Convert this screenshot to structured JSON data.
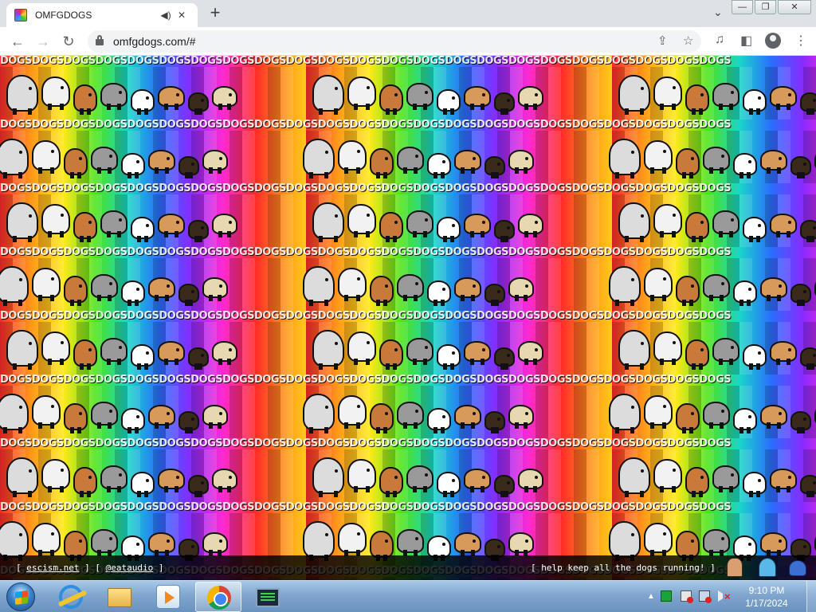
{
  "browser": {
    "tab_title": "OMFGDOGS",
    "url": "omfgdogs.com/#",
    "new_tab_label": "+",
    "tab_search_icon": "chevron-down-icon"
  },
  "page": {
    "background_text": "DOGSDOGSDOGSDOGSDOGSDOGSDOGSDOGSDOGSDOGSDOGSDOGSDOGSDOGSDOGSDOGSDOGSDOGSDOGSDOGSDOGSDOGSDOGS",
    "rainbow_colors": [
      "#ff2a2a",
      "#ff9a1a",
      "#ffe91a",
      "#4de31a",
      "#19d6c8",
      "#2a6dff",
      "#8a2aff",
      "#ff2ad1"
    ],
    "dog_colors": [
      "#dcdcdc",
      "#f2f2f2",
      "#c97a3a",
      "#9a9a9a",
      "#ffffff",
      "#d89a5a",
      "#3a2a1a",
      "#e8d8b0"
    ]
  },
  "footer": {
    "bracket_open": "[ ",
    "link1": "escism.net",
    "sep": " ] [ ",
    "link2": "@eataudio",
    "bracket_close": " ]",
    "right_text": "[ help keep all the dogs running! ]"
  },
  "taskbar": {
    "clock_time": "9:10 PM",
    "clock_date": "1/17/2024",
    "tray_expand": "▲"
  }
}
